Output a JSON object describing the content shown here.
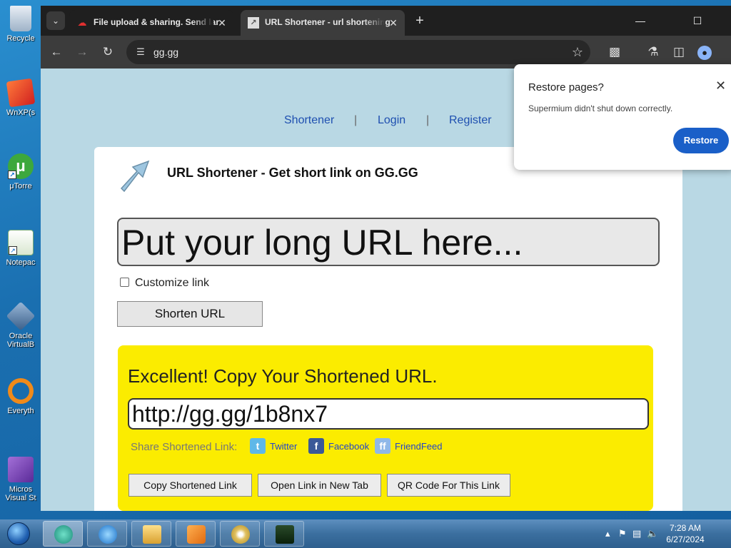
{
  "desktop": {
    "icons": [
      {
        "label": "Recycle",
        "icon": "recycle-bin-icon"
      },
      {
        "label": "WnXP(s",
        "icon": "virtual-xp-icon"
      },
      {
        "label": "μTorre",
        "icon": "utorrent-icon"
      },
      {
        "label": "Notepac",
        "icon": "notepad-icon"
      },
      {
        "label": "Oracle VirtualB",
        "icon": "virtualbox-icon"
      },
      {
        "label": "Everyth",
        "icon": "everything-search-icon"
      },
      {
        "label": "Micros Visual St",
        "icon": "visual-studio-icon"
      }
    ]
  },
  "browser": {
    "tabs": [
      {
        "title": "File upload & sharing. Send lar",
        "active": false
      },
      {
        "title": "URL Shortener - url shortening",
        "active": true
      }
    ],
    "address": "gg.gg"
  },
  "page": {
    "nav": {
      "shortener": "Shortener",
      "login": "Login",
      "register": "Register",
      "sep": "|"
    },
    "title": "URL Shortener - Get short link on GG.GG",
    "url_placeholder": "Put your long URL here...",
    "customize_label": "Customize link",
    "shorten_button": "Shorten URL",
    "result": {
      "heading": "Excellent! Copy Your Shortened URL.",
      "short_url": "http://gg.gg/1b8nx7",
      "share_label": "Share Shortened Link:",
      "share": [
        {
          "label": "Twitter",
          "icon": "twitter-icon"
        },
        {
          "label": "Facebook",
          "icon": "facebook-icon"
        },
        {
          "label": "FriendFeed",
          "icon": "friendfeed-icon"
        }
      ],
      "buttons": {
        "copy": "Copy Shortened Link",
        "open": "Open Link in New Tab",
        "qr": "QR Code For This Link"
      }
    }
  },
  "popup": {
    "title": "Restore pages?",
    "message": "Supermium didn't shut down correctly.",
    "restore": "Restore"
  },
  "taskbar": {
    "time": "7:28 AM",
    "date": "6/27/2024"
  },
  "colors": {
    "page_bg": "#b9d8e4",
    "result_bg": "#fbec00",
    "link": "#1e4fb0",
    "restore_button": "#1a5fc8"
  }
}
